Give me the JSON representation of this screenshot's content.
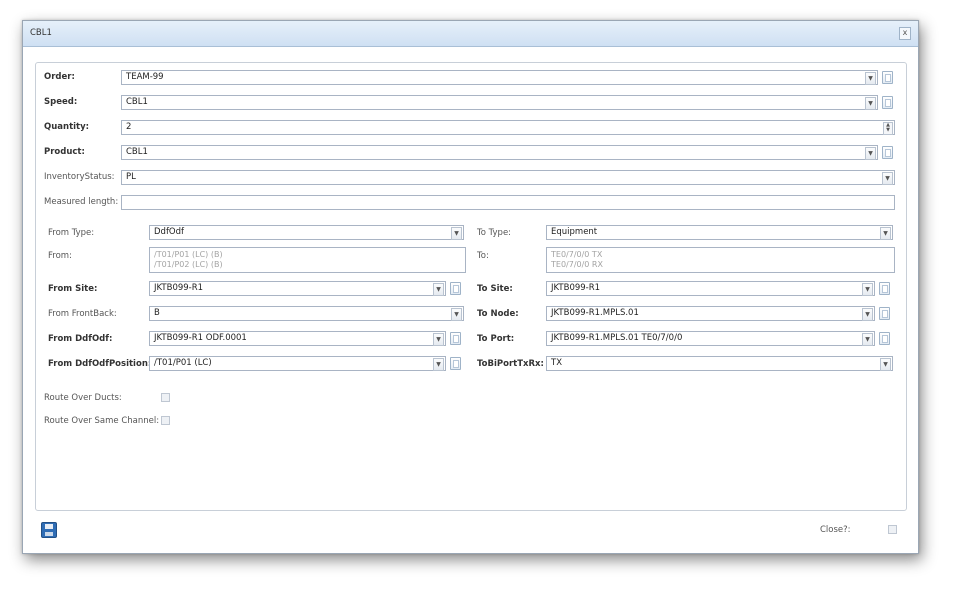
{
  "dialog": {
    "title": "CBL1",
    "close_glyph": "x"
  },
  "form": {
    "order": {
      "label": "Order:",
      "value": "TEAM-99"
    },
    "speed": {
      "label": "Speed:",
      "value": "CBL1"
    },
    "quantity": {
      "label": "Quantity:",
      "value": "2"
    },
    "product": {
      "label": "Product:",
      "value": "CBL1"
    },
    "inventory_status": {
      "label": "InventoryStatus:",
      "value": "PL"
    },
    "measured_length": {
      "label": "Measured length:",
      "value": ""
    }
  },
  "left": {
    "from_type": {
      "label": "From Type:",
      "value": "DdfOdf"
    },
    "from": {
      "label": "From:",
      "lines": [
        "/T01/P01 (LC) (B)",
        "/T01/P02 (LC) (B)"
      ]
    },
    "from_site": {
      "label": "From Site:",
      "value": "JKTB099-R1"
    },
    "from_frontback": {
      "label": "From FrontBack:",
      "value": "B"
    },
    "from_ddfodf": {
      "label": "From DdfOdf:",
      "value": "JKTB099-R1 ODF.0001"
    },
    "from_ddfodf_position": {
      "label": "From DdfOdfPosition:",
      "value": "/T01/P01 (LC)"
    }
  },
  "right": {
    "to_type": {
      "label": "To Type:",
      "value": "Equipment"
    },
    "to": {
      "label": "To:",
      "lines": [
        "TE0/7/0/0 TX",
        "TE0/7/0/0 RX"
      ]
    },
    "to_site": {
      "label": "To Site:",
      "value": "JKTB099-R1"
    },
    "to_node": {
      "label": "To Node:",
      "value": "JKTB099-R1.MPLS.01"
    },
    "to_port": {
      "label": "To Port:",
      "value": "JKTB099-R1.MPLS.01  TE0/7/0/0"
    },
    "to_bi_port_txrx": {
      "label": "ToBiPortTxRx:",
      "value": "TX"
    }
  },
  "options": {
    "route_over_ducts": {
      "label": "Route Over Ducts:",
      "checked": false
    },
    "route_over_same_channel": {
      "label": "Route Over Same Channel:",
      "checked": false
    }
  },
  "footer": {
    "close_label": "Close?:",
    "close_checked": false
  },
  "icons": {
    "dropdown": "chevron-down-icon",
    "picker": "document-picker-icon",
    "save": "floppy-disk-icon"
  },
  "dropdown_glyph": "▼",
  "spin_up": "▲",
  "spin_down": "▼"
}
